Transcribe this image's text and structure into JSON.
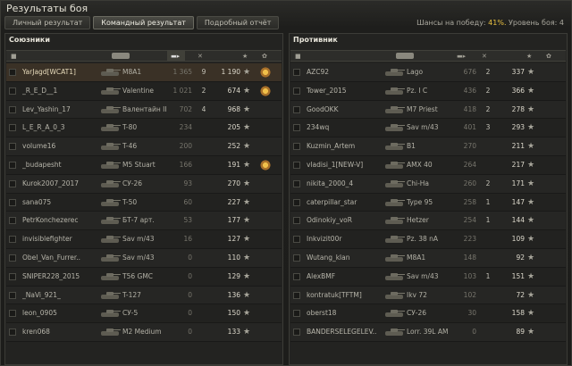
{
  "window": {
    "title": "Результаты боя",
    "tabs": [
      {
        "label": "Личный результат",
        "active": false
      },
      {
        "label": "Командный результат",
        "active": true
      },
      {
        "label": "Подробный отчёт",
        "active": false
      }
    ],
    "chances_label": "Шансы на победу:",
    "chances_value": "41%.",
    "battle_level": "Уровень боя: 4"
  },
  "colors": {
    "accent": "#e8c040",
    "highlight_row": "#3a3126"
  },
  "icons": {
    "checkbox": "square-icon",
    "tank_header": "tank-icon",
    "damage_header": "shell-icon",
    "kills_header": "crossed-tank-icon",
    "xp_header": "star-icon",
    "medal": "medal-icon"
  },
  "allies": {
    "title": "Союзники",
    "rows": [
      {
        "player": "YarJagd[WCAT1]",
        "tank": "M8A1",
        "damage": "1 365",
        "kills": "9",
        "xp": "1 190",
        "medal": true,
        "highlight": true
      },
      {
        "player": "_R_E_D__1",
        "tank": "Valentine",
        "damage": "1 021",
        "kills": "2",
        "xp": "674",
        "medal": true
      },
      {
        "player": "Lev_Yashin_17",
        "tank": "Валентайн II",
        "damage": "702",
        "kills": "4",
        "xp": "968"
      },
      {
        "player": "L_E_R_A_0_3",
        "tank": "T-80",
        "damage": "234",
        "kills": "",
        "xp": "205"
      },
      {
        "player": "volume16",
        "tank": "T-46",
        "damage": "200",
        "kills": "",
        "xp": "252"
      },
      {
        "player": "_budapesht",
        "tank": "M5 Stuart",
        "damage": "166",
        "kills": "",
        "xp": "191",
        "medal": true
      },
      {
        "player": "Kurok2007_2017",
        "tank": "СУ-26",
        "damage": "93",
        "kills": "",
        "xp": "270"
      },
      {
        "player": "sana075",
        "tank": "T-50",
        "damage": "60",
        "kills": "",
        "xp": "227"
      },
      {
        "player": "PetrKonchezerec",
        "tank": "БТ-7 арт.",
        "damage": "53",
        "kills": "",
        "xp": "177"
      },
      {
        "player": "invisiblefighter",
        "tank": "Sav m/43",
        "damage": "16",
        "kills": "",
        "xp": "127"
      },
      {
        "player": "Obel_Van_Furrer..",
        "tank": "Sav m/43",
        "damage": "0",
        "kills": "",
        "xp": "110"
      },
      {
        "player": "SNIPER228_2015",
        "tank": "T56 GMC",
        "damage": "0",
        "kills": "",
        "xp": "129"
      },
      {
        "player": "_NaVi_921_",
        "tank": "T-127",
        "damage": "0",
        "kills": "",
        "xp": "136"
      },
      {
        "player": "leon_0905",
        "tank": "СУ-5",
        "damage": "0",
        "kills": "",
        "xp": "150"
      },
      {
        "player": "kren068",
        "tank": "M2 Medium",
        "damage": "0",
        "kills": "",
        "xp": "133"
      }
    ]
  },
  "enemies": {
    "title": "Противник",
    "rows": [
      {
        "player": "AZC92",
        "tank": "Lago",
        "damage": "676",
        "kills": "2",
        "xp": "337"
      },
      {
        "player": "Tower_2015",
        "tank": "Pz. I C",
        "damage": "436",
        "kills": "2",
        "xp": "366"
      },
      {
        "player": "GoodOKK",
        "tank": "M7 Priest",
        "damage": "418",
        "kills": "2",
        "xp": "278"
      },
      {
        "player": "234wq",
        "tank": "Sav m/43",
        "damage": "401",
        "kills": "3",
        "xp": "293"
      },
      {
        "player": "Kuzmin_Artem",
        "tank": "B1",
        "damage": "270",
        "kills": "",
        "xp": "211"
      },
      {
        "player": "vladisi_1[NEW-V]",
        "tank": "AMX 40",
        "damage": "264",
        "kills": "",
        "xp": "217"
      },
      {
        "player": "nikita_2000_4",
        "tank": "Chi-Ha",
        "damage": "260",
        "kills": "2",
        "xp": "171"
      },
      {
        "player": "caterpillar_star",
        "tank": "Type 95",
        "damage": "258",
        "kills": "1",
        "xp": "147"
      },
      {
        "player": "Odinokiy_voR",
        "tank": "Hetzer",
        "damage": "254",
        "kills": "1",
        "xp": "144"
      },
      {
        "player": "Inkvizit00r",
        "tank": "Pz. 38 nA",
        "damage": "223",
        "kills": "",
        "xp": "109"
      },
      {
        "player": "Wutang_klan",
        "tank": "M8A1",
        "damage": "148",
        "kills": "",
        "xp": "92"
      },
      {
        "player": "AlexBMF",
        "tank": "Sav m/43",
        "damage": "103",
        "kills": "1",
        "xp": "151"
      },
      {
        "player": "kontratuk[TFTM]",
        "tank": "Ikv 72",
        "damage": "102",
        "kills": "",
        "xp": "72"
      },
      {
        "player": "oberst18",
        "tank": "СУ-26",
        "damage": "30",
        "kills": "",
        "xp": "158"
      },
      {
        "player": "BANDERSELEGELEV..",
        "tank": "Lorr. 39L AM",
        "damage": "0",
        "kills": "",
        "xp": "89"
      }
    ]
  }
}
